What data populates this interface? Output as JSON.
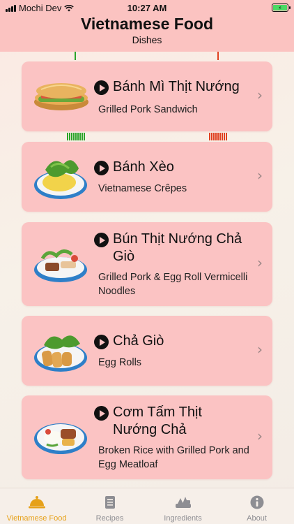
{
  "status_bar": {
    "carrier": "Mochi Dev",
    "time": "10:27 AM"
  },
  "header": {
    "title": "Vietnamese Food",
    "subtitle": "Dishes"
  },
  "dishes": [
    {
      "title": "Bánh Mì Thịt Nướng",
      "subtitle": "Grilled Pork Sandwich",
      "icon": "banh-mi-image"
    },
    {
      "title": "Bánh Xèo",
      "subtitle": "Vietnamese Crêpes",
      "icon": "banh-xeo-image"
    },
    {
      "title": "Bún Thịt Nướng Chả Giò",
      "subtitle": "Grilled Pork & Egg Roll Vermicelli Noodles",
      "icon": "bun-thit-nuong-image"
    },
    {
      "title": "Chả Giò",
      "subtitle": "Egg Rolls",
      "icon": "cha-gio-image"
    },
    {
      "title": "Cơm Tấm Thịt Nướng Chả",
      "subtitle": "Broken Rice with Grilled Pork and Egg Meatloaf",
      "icon": "com-tam-image"
    }
  ],
  "tabs": [
    {
      "label": "Vietnamese Food",
      "icon": "cloche-icon",
      "active": true
    },
    {
      "label": "Recipes",
      "icon": "recipe-book-icon",
      "active": false
    },
    {
      "label": "Ingredients",
      "icon": "ingredients-icon",
      "active": false
    },
    {
      "label": "About",
      "icon": "info-icon",
      "active": false
    }
  ],
  "colors": {
    "header": "#fbc3c1",
    "card": "#fbc3c3",
    "tab_active": "#e6a11a",
    "tab_inactive": "#8e8e93"
  }
}
